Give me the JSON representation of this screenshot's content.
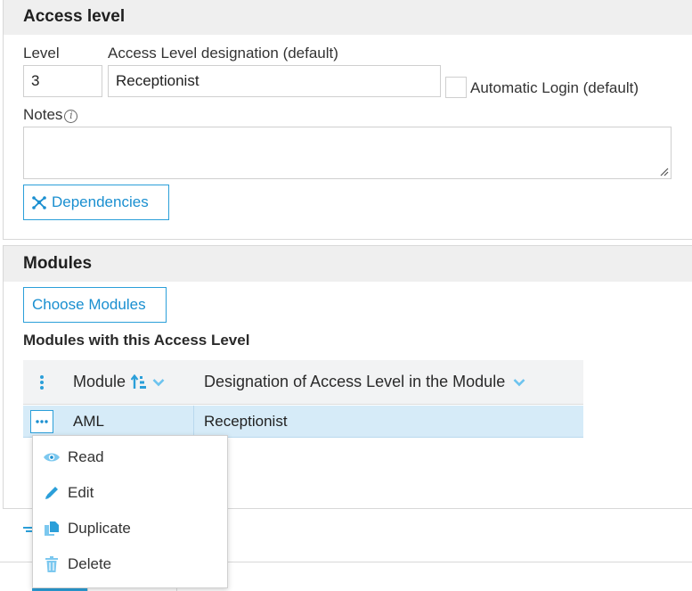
{
  "access_panel": {
    "title": "Access level",
    "level_label": "Level",
    "level_value": "3",
    "designation_label": "Access Level designation (default)",
    "designation_value": "Receptionist",
    "auto_login_label": "Automatic Login (default)",
    "notes_label": "Notes",
    "notes_value": "",
    "dependencies_button": "Dependencies"
  },
  "modules_panel": {
    "title": "Modules",
    "choose_button": "Choose Modules",
    "subheading": "Modules with this Access Level",
    "columns": [
      "Module",
      "Designation of Access Level in the Module"
    ],
    "rows": [
      {
        "module": "AML",
        "designation": "Receptionist"
      }
    ]
  },
  "row_menu": {
    "items": [
      {
        "label": "Read",
        "icon": "eye-icon"
      },
      {
        "label": "Edit",
        "icon": "pencil-icon"
      },
      {
        "label": "Duplicate",
        "icon": "duplicate-icon"
      },
      {
        "label": "Delete",
        "icon": "trash-icon"
      }
    ]
  },
  "colors": {
    "accent": "#2b9fd9",
    "row_selected": "#d6ebf8",
    "header_bg": "#efefef"
  }
}
